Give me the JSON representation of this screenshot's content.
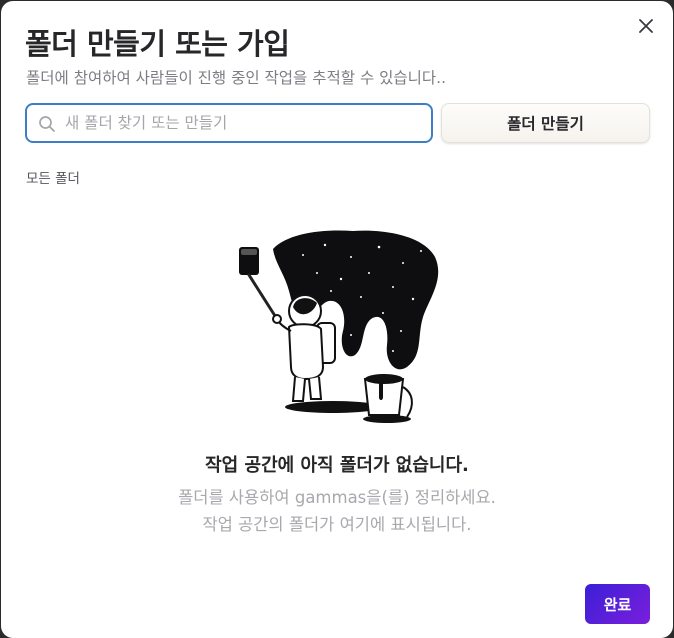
{
  "dialog": {
    "title": "폴더 만들기 또는 가입",
    "subtitle": "폴더에 참여하여 사람들이 진행 중인 작업을 추적할 수 있습니다..",
    "close_icon": "close-icon"
  },
  "search": {
    "placeholder": "새 폴더 찾기 또는 만들기",
    "value": "",
    "icon": "search-icon"
  },
  "create_button": {
    "label": "폴더 만들기"
  },
  "section": {
    "label": "모든 폴더"
  },
  "empty_state": {
    "illustration": "astronaut-painting-space-illustration",
    "title": "작업 공간에 아직 폴더가 없습니다.",
    "line1": "폴더를 사용하여 gammas을(를) 정리하세요.",
    "line2": "작업 공간의 폴더가 여기에 표시됩니다."
  },
  "done_button": {
    "label": "완료",
    "color_start": "#3b1fd6",
    "color_end": "#7a1fdc"
  },
  "colors": {
    "focus_border": "#3d7fc4",
    "title_text": "#27272a",
    "muted_text": "#a8a8ae"
  }
}
